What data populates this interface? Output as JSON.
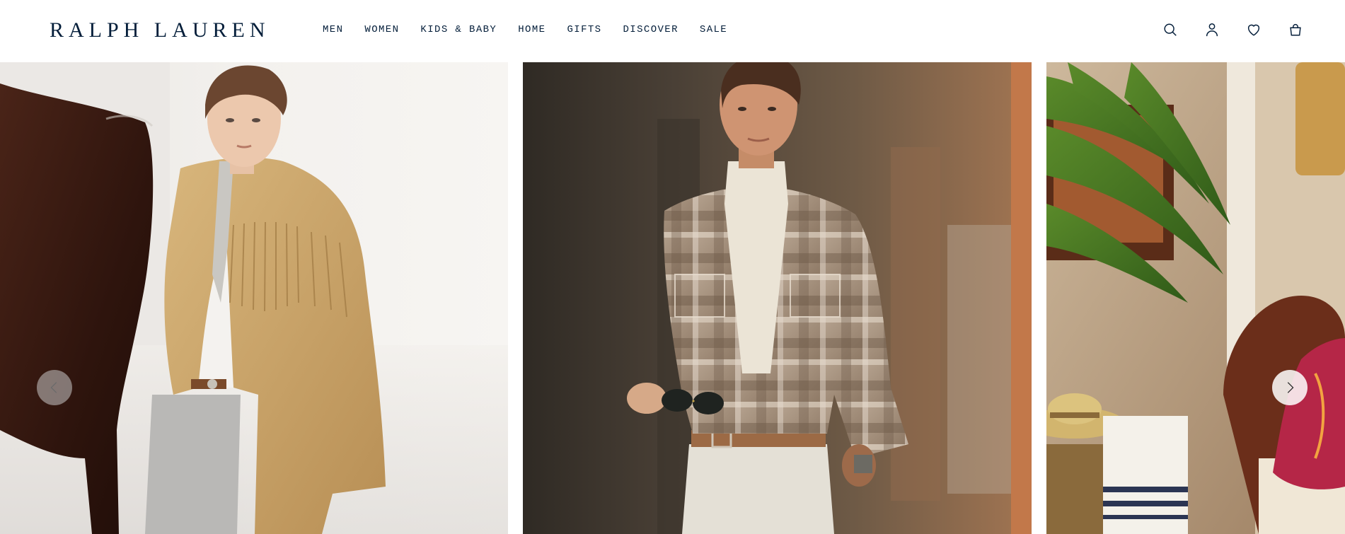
{
  "brand": {
    "logo_text": "RALPH LAUREN"
  },
  "nav": {
    "items": [
      {
        "label": "MEN"
      },
      {
        "label": "WOMEN"
      },
      {
        "label": "KIDS & BABY"
      },
      {
        "label": "HOME"
      },
      {
        "label": "GIFTS"
      },
      {
        "label": "DISCOVER"
      },
      {
        "label": "SALE"
      }
    ]
  },
  "utility": {
    "icons": [
      "search-icon",
      "account-icon",
      "wishlist-heart-icon",
      "shopping-bag-icon"
    ]
  },
  "carousel": {
    "slides": [
      {
        "subject": "woman in suede fringe jacket beside horse"
      },
      {
        "subject": "man in plaid shirt and turtleneck holding sunglasses"
      },
      {
        "subject": "interior with palm fronds, straw hat and paisley scarf"
      }
    ],
    "controls": {
      "prev_icon": "chevron-left-icon",
      "next_icon": "chevron-right-icon"
    }
  },
  "colors": {
    "brand_navy": "#041e3a",
    "background": "#ffffff"
  }
}
